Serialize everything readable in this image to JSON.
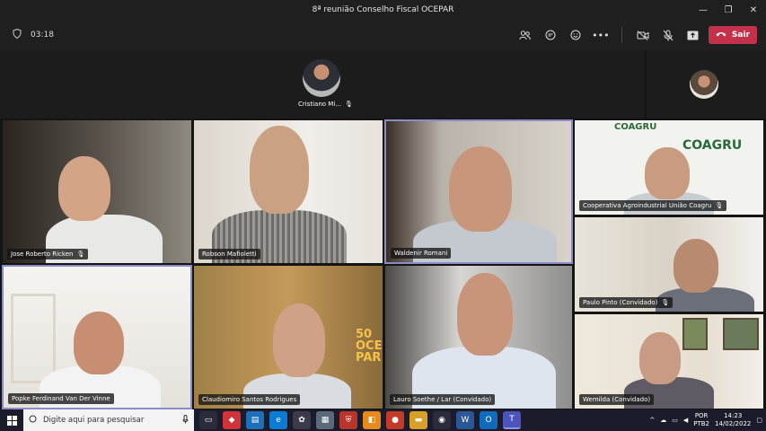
{
  "window": {
    "title": "8ª reunião Conselho Fiscal OCEPAR",
    "controls": [
      "—",
      "❐",
      "✕"
    ]
  },
  "toolbar": {
    "timer": "03:18",
    "leave_label": "Sair",
    "icons": [
      "people-icon",
      "chat-icon",
      "reactions-icon",
      "more-icon",
      "camera-off-icon",
      "mic-off-icon",
      "share-icon"
    ]
  },
  "top_row": {
    "presenter_name": "Cristiano Mi...",
    "self_view": ""
  },
  "participants": [
    {
      "name": "Jose Roberto Ricken",
      "muted": true
    },
    {
      "name": "Robson Mafioletti",
      "muted": false
    },
    {
      "name": "Waldenir Romani",
      "muted": false
    },
    {
      "name": "Cooperativa Agroindustrial União Coagru",
      "muted": true
    },
    {
      "name": "Paulo Pinto (Convidado)",
      "muted": true
    },
    {
      "name": "Popke Ferdinand Van Der Vinne",
      "muted": false
    },
    {
      "name": "Claudiomiro Santos Rodrigues",
      "muted": false
    },
    {
      "name": "Lauro Soethe / Lar (Convidado)",
      "muted": false
    },
    {
      "name": "Wemilda (Convidado)",
      "muted": false
    }
  ],
  "background_text": {
    "coagru_logo": "COAGRU",
    "ocepar_logo": "50 OCEPAR"
  },
  "taskbar": {
    "search_placeholder": "Digite aqui para pesquisar",
    "language": "POR",
    "keyboard": "PTB2",
    "time": "14:23",
    "date": "14/02/2022"
  },
  "colors": {
    "leave": "#c4314b",
    "active_border": "#8b8cc7",
    "taskbar": "#1b1b2b"
  }
}
